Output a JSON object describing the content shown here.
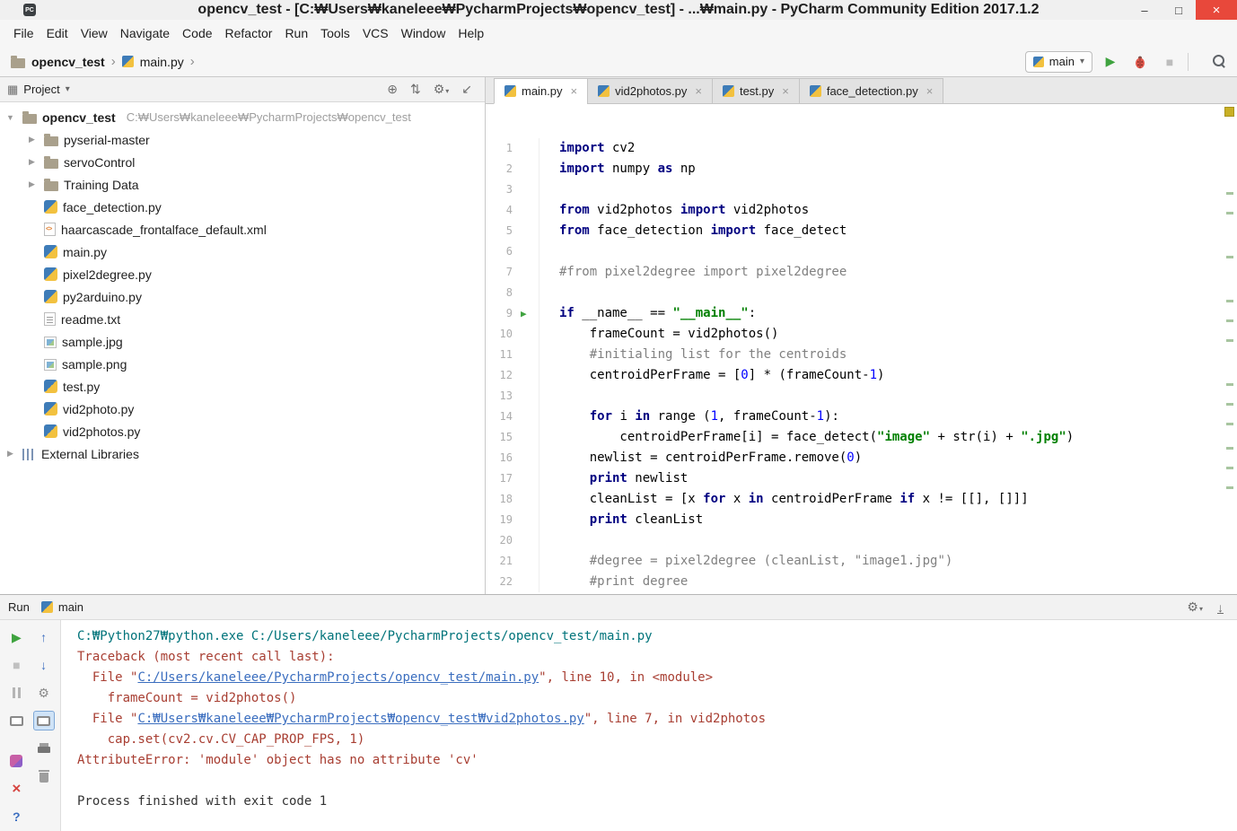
{
  "colors": {
    "keyword": "#000080",
    "string": "#008000",
    "comment": "#808080",
    "number": "#0000ff",
    "cmd": "#00737a",
    "error": "#a83e32",
    "link": "#3b6ebf",
    "green": "#3fa33f",
    "blue": "#3d6fc0",
    "yellow": "#c9b025",
    "close_red": "#e8483b"
  },
  "icons": {
    "app": "PC",
    "chevron_down": "▾",
    "breadcrumb_sep": "›",
    "collapsed": "▶",
    "expanded": "▼",
    "gear": "⚙",
    "locate": "⊕",
    "collapse_all": "⇅",
    "hide_left": "↙",
    "hide_down": "↓",
    "panel_menu": "▦",
    "play": "▶",
    "stop": "■",
    "up_arrow": "↑",
    "down_arrow": "↓",
    "close": "×",
    "minimize": "–",
    "maximize": "□",
    "help": "?"
  },
  "title_bar": {
    "title": "opencv_test - [C:₩Users₩kaneleee₩PycharmProjects₩opencv_test] - ...₩main.py - PyCharm Community Edition 2017.1.2"
  },
  "menu": {
    "items": [
      "File",
      "Edit",
      "View",
      "Navigate",
      "Code",
      "Refactor",
      "Run",
      "Tools",
      "VCS",
      "Window",
      "Help"
    ]
  },
  "toolbar": {
    "breadcrumbs": [
      "opencv_test",
      "main.py"
    ],
    "run_config": "main"
  },
  "project": {
    "header": "Project",
    "items": [
      {
        "label": "opencv_test",
        "path": "C:₩Users₩kaneleee₩PycharmProjects₩opencv_test",
        "type": "folder",
        "level": 0,
        "arrow": "expanded",
        "bold": true
      },
      {
        "label": "pyserial-master",
        "type": "folder",
        "level": 1,
        "arrow": "collapsed"
      },
      {
        "label": "servoControl",
        "type": "folder",
        "level": 1,
        "arrow": "collapsed"
      },
      {
        "label": "Training Data",
        "type": "folder",
        "level": 1,
        "arrow": "collapsed"
      },
      {
        "label": "face_detection.py",
        "type": "py",
        "level": 1
      },
      {
        "label": "haarcascade_frontalface_default.xml",
        "type": "xml",
        "level": 1
      },
      {
        "label": "main.py",
        "type": "py",
        "level": 1
      },
      {
        "label": "pixel2degree.py",
        "type": "py",
        "level": 1
      },
      {
        "label": "py2arduino.py",
        "type": "py",
        "level": 1
      },
      {
        "label": "readme.txt",
        "type": "txt",
        "level": 1
      },
      {
        "label": "sample.jpg",
        "type": "img",
        "level": 1
      },
      {
        "label": "sample.png",
        "type": "img",
        "level": 1
      },
      {
        "label": "test.py",
        "type": "py",
        "level": 1
      },
      {
        "label": "vid2photo.py",
        "type": "py",
        "level": 1
      },
      {
        "label": "vid2photos.py",
        "type": "py",
        "level": 1
      },
      {
        "label": "External Libraries",
        "type": "lib",
        "level": 0,
        "arrow": "collapsed"
      }
    ]
  },
  "editor": {
    "tabs": [
      {
        "label": "main.py",
        "active": true
      },
      {
        "label": "vid2photos.py",
        "active": false
      },
      {
        "label": "test.py",
        "active": false
      },
      {
        "label": "face_detection.py",
        "active": false
      }
    ],
    "stripe_marks": [
      0.18,
      0.22,
      0.31,
      0.4,
      0.44,
      0.48,
      0.57,
      0.61,
      0.65,
      0.7,
      0.74,
      0.78
    ],
    "code": [
      {
        "seg": [
          [
            "kw",
            "import"
          ],
          [
            "t",
            " cv2"
          ]
        ]
      },
      {
        "seg": [
          [
            "kw",
            "import"
          ],
          [
            "t",
            " numpy "
          ],
          [
            "kw",
            "as"
          ],
          [
            "t",
            " np"
          ]
        ]
      },
      {
        "seg": []
      },
      {
        "seg": [
          [
            "kw",
            "from"
          ],
          [
            "t",
            " vid2photos "
          ],
          [
            "kw",
            "import"
          ],
          [
            "t",
            " vid2photos"
          ]
        ]
      },
      {
        "seg": [
          [
            "kw",
            "from"
          ],
          [
            "t",
            " face_detection "
          ],
          [
            "kw",
            "import"
          ],
          [
            "t",
            " face_detect"
          ]
        ]
      },
      {
        "seg": []
      },
      {
        "seg": [
          [
            "com",
            "#from pixel2degree import pixel2degree"
          ]
        ]
      },
      {
        "seg": []
      },
      {
        "run": true,
        "seg": [
          [
            "kw",
            "if"
          ],
          [
            "t",
            " __name__ == "
          ],
          [
            "str",
            "\"__main__\""
          ],
          [
            "t",
            ":"
          ]
        ]
      },
      {
        "seg": [
          [
            "t",
            "    frameCount = vid2photos()"
          ]
        ]
      },
      {
        "seg": [
          [
            "t",
            "    "
          ],
          [
            "com",
            "#initialing list for the centroids"
          ]
        ]
      },
      {
        "seg": [
          [
            "t",
            "    centroidPerFrame = ["
          ],
          [
            "num",
            "0"
          ],
          [
            "t",
            "] * (frameCount-"
          ],
          [
            "num",
            "1"
          ],
          [
            "t",
            ")"
          ]
        ]
      },
      {
        "seg": []
      },
      {
        "seg": [
          [
            "t",
            "    "
          ],
          [
            "kw",
            "for"
          ],
          [
            "t",
            " i "
          ],
          [
            "kw",
            "in"
          ],
          [
            "t",
            " range ("
          ],
          [
            "num",
            "1"
          ],
          [
            "t",
            ", frameCount-"
          ],
          [
            "num",
            "1"
          ],
          [
            "t",
            "):"
          ]
        ]
      },
      {
        "seg": [
          [
            "t",
            "        centroidPerFrame[i] = face_detect("
          ],
          [
            "str",
            "\"image\""
          ],
          [
            "t",
            " + str(i) + "
          ],
          [
            "str",
            "\".jpg\""
          ],
          [
            "t",
            ")"
          ]
        ]
      },
      {
        "seg": [
          [
            "t",
            "    newlist = centroidPerFrame.remove("
          ],
          [
            "num",
            "0"
          ],
          [
            "t",
            ")"
          ]
        ]
      },
      {
        "seg": [
          [
            "t",
            "    "
          ],
          [
            "kw",
            "print"
          ],
          [
            "t",
            " newlist"
          ]
        ]
      },
      {
        "seg": [
          [
            "t",
            "    cleanList = [x "
          ],
          [
            "kw",
            "for"
          ],
          [
            "t",
            " x "
          ],
          [
            "kw",
            "in"
          ],
          [
            "t",
            " centroidPerFrame "
          ],
          [
            "kw",
            "if"
          ],
          [
            "t",
            " x != [[], []]]"
          ]
        ]
      },
      {
        "seg": [
          [
            "t",
            "    "
          ],
          [
            "kw",
            "print"
          ],
          [
            "t",
            " cleanList"
          ]
        ]
      },
      {
        "seg": []
      },
      {
        "seg": [
          [
            "t",
            "    "
          ],
          [
            "com",
            "#degree = pixel2degree (cleanList, \"image1.jpg\")"
          ]
        ]
      },
      {
        "seg": [
          [
            "t",
            "    "
          ],
          [
            "com",
            "#print degree"
          ]
        ]
      }
    ]
  },
  "run_panel": {
    "title": "Run",
    "tab": "main",
    "console": [
      [
        [
          "cmd",
          "C:₩Python27₩python.exe C:/Users/kaneleee/PycharmProjects/opencv_test/main.py"
        ]
      ],
      [
        [
          "err",
          "Traceback (most recent call last):"
        ]
      ],
      [
        [
          "err",
          "  File \""
        ],
        [
          "link",
          "C:/Users/kaneleee/PycharmProjects/opencv_test/main.py"
        ],
        [
          "err",
          "\", line 10, in <module>"
        ]
      ],
      [
        [
          "err",
          "    frameCount = vid2photos()"
        ]
      ],
      [
        [
          "err",
          "  File \""
        ],
        [
          "link",
          "C:₩Users₩kaneleee₩PycharmProjects₩opencv_test₩vid2photos.py"
        ],
        [
          "err",
          "\", line 7, in vid2photos"
        ]
      ],
      [
        [
          "err",
          "    cap.set(cv2.cv.CV_CAP_PROP_FPS, 1)"
        ]
      ],
      [
        [
          "err",
          "AttributeError: 'module' object has no attribute 'cv'"
        ]
      ],
      [
        [
          "t",
          ""
        ]
      ],
      [
        [
          "t",
          "Process finished with exit code 1"
        ]
      ]
    ]
  }
}
